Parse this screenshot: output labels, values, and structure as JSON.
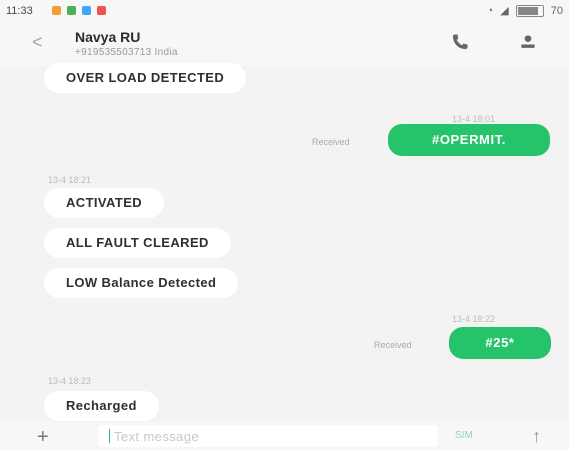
{
  "status_bar": {
    "time": "11:33",
    "battery": "70"
  },
  "contact": {
    "name": "Navya RU",
    "phone": "+919535503713 India"
  },
  "messages": [
    {
      "direction": "in",
      "text": "OVER LOAD DETECTED"
    },
    {
      "direction": "out",
      "timestamp": "13-4 18:01",
      "status": "Received",
      "text": "#OPERMIT."
    },
    {
      "direction": "in",
      "timestamp": "13-4 18:21",
      "text": "ACTIVATED"
    },
    {
      "direction": "in",
      "text": "ALL FAULT CLEARED"
    },
    {
      "direction": "in",
      "text": "LOW Balance Detected"
    },
    {
      "direction": "out",
      "timestamp": "13-4 18:22",
      "status": "Received",
      "text": "#25*"
    },
    {
      "direction": "in",
      "timestamp": "13-4 18:23",
      "text": "Recharged"
    }
  ],
  "composer": {
    "placeholder": "Text message",
    "sim_label": "SIM"
  },
  "colors": {
    "accent": "#26c46a",
    "background": "#f3f3f3",
    "incoming_bubble": "#ffffff"
  }
}
